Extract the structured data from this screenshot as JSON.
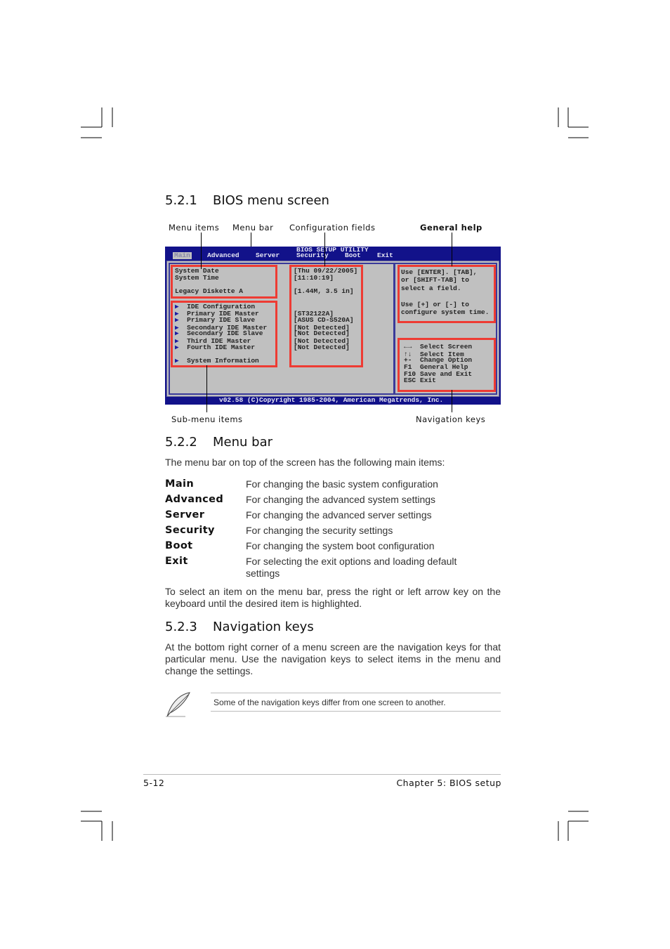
{
  "section1": {
    "number": "5.2.1",
    "title": "BIOS menu screen"
  },
  "callouts": {
    "menu_items": "Menu items",
    "menu_bar": "Menu bar",
    "config_fields": "Configuration fields",
    "general_help": "General help",
    "submenu_items": "Sub-menu items",
    "nav_keys": "Navigation keys"
  },
  "bios": {
    "title": "BIOS SETUP UTILITY",
    "menu": [
      "Main",
      "Advanced",
      "Server",
      "Security",
      "Boot",
      "Exit"
    ],
    "items": [
      "System Date",
      "System Time",
      "Legacy Diskette A"
    ],
    "submenus": [
      "IDE Configuration",
      "Primary IDE Master",
      "Primary IDE Slave",
      "Secondary IDE Master",
      "Secondary IDE Slave",
      "Third IDE Master",
      "Fourth IDE Master",
      "System Information"
    ],
    "values": [
      "[Thu 09/22/2005]",
      "[11:10:19]",
      "[1.44M, 3.5 in]",
      "[ST32122A]",
      "[ASUS CD-S520A]",
      "[Not Detected]",
      "[Not Detected]",
      "[Not Detected]",
      "[Not Detected]"
    ],
    "help": [
      "Use [ENTER]. [TAB],",
      "or [SHIFT-TAB] to",
      "select a field.",
      "Use [+] or [-] to",
      "configure system time."
    ],
    "nav": [
      {
        "key": "←→",
        "desc": "Select Screen"
      },
      {
        "key": "↑↓",
        "desc": "Select Item"
      },
      {
        "key": "+-",
        "desc": "Change Option"
      },
      {
        "key": "F1",
        "desc": "General Help"
      },
      {
        "key": "F10",
        "desc": "Save and Exit"
      },
      {
        "key": "ESC",
        "desc": "Exit"
      }
    ],
    "footer": "v02.58 (C)Copyright 1985-2004, American Megatrends, Inc."
  },
  "section2": {
    "number": "5.2.2",
    "title": "Menu bar",
    "intro": "The menu bar on top of the screen has the following main items:",
    "items": [
      {
        "term": "Main",
        "desc": "For changing the basic system configuration"
      },
      {
        "term": "Advanced",
        "desc": "For changing the advanced system settings"
      },
      {
        "term": "Server",
        "desc": "For changing the advanced server settings"
      },
      {
        "term": "Security",
        "desc": "For changing the security settings"
      },
      {
        "term": "Boot",
        "desc": "For changing the system boot configuration"
      },
      {
        "term": "Exit",
        "desc": "For selecting the exit options and loading default settings"
      }
    ],
    "outro": "To select an item on the menu bar, press the right or left arrow key on the keyboard until the desired item is highlighted."
  },
  "section3": {
    "number": "5.2.3",
    "title": "Navigation keys",
    "body": "At the bottom right corner of a menu screen are the navigation keys for that particular menu. Use the navigation keys to select items in the menu and change the settings.",
    "note": "Some of the navigation keys differ from one screen to another."
  },
  "footer": {
    "page": "5-12",
    "chapter": "Chapter 5: BIOS setup"
  },
  "colors": {
    "bios_blue": "#12128a",
    "bios_gray": "#c0c0c0",
    "highlight_red": "#ee3b33"
  }
}
